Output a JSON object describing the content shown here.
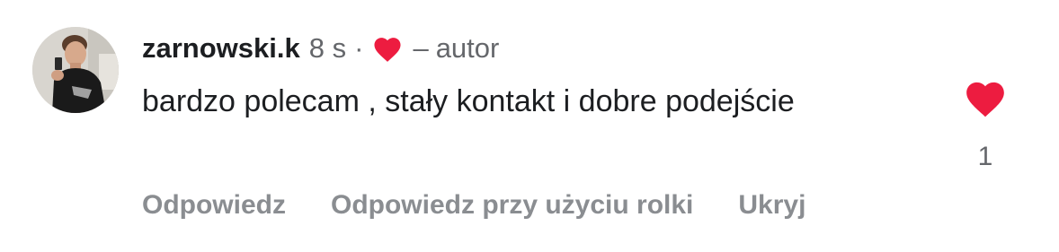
{
  "comment": {
    "username": "zarnowski.k",
    "time": "8 s",
    "separator": "·",
    "author_dash": "–",
    "author_label": "autor",
    "text": "bardzo polecam , stały kontakt i dobre podejście",
    "like_count": "1"
  },
  "actions": {
    "reply": "Odpowiedz",
    "reply_reel": "Odpowiedz przy użyciu rolki",
    "hide": "Ukryj"
  },
  "icons": {
    "author_like": "heart-icon",
    "like": "heart-icon",
    "avatar": "profile-photo"
  },
  "colors": {
    "heart": "#ed1c40",
    "username": "#1c1e21",
    "meta": "#65676b",
    "action": "#8a8d91"
  }
}
